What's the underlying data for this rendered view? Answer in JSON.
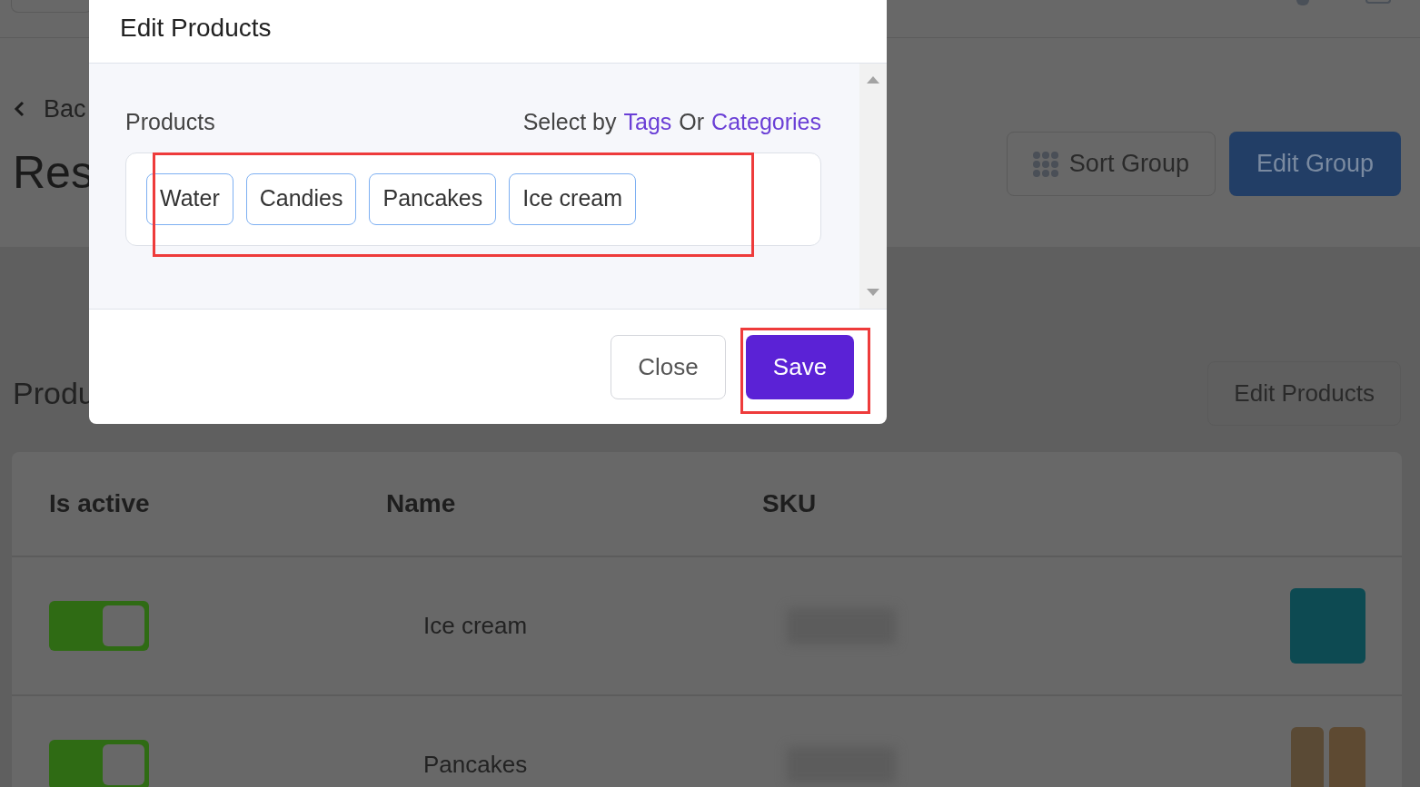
{
  "page": {
    "back_link": "Bac",
    "title": "Res",
    "buttons": [
      {
        "label": "Sort Group",
        "kind": "outline"
      },
      {
        "label": "Edit Group",
        "kind": "primary"
      }
    ],
    "section_title": "Produ",
    "section_button": "Edit Products"
  },
  "table": {
    "columns": [
      "Is active",
      "Name",
      "SKU"
    ],
    "rows": [
      {
        "active": true,
        "name": "Ice cream",
        "kind": "single"
      },
      {
        "active": true,
        "name": "Pancakes",
        "kind": "pair"
      }
    ]
  },
  "dialog": {
    "title": "Edit Products",
    "field_label": "Products",
    "select_by": {
      "prefix": "Select by",
      "links": [
        "Tags",
        "Categories"
      ],
      "separator": "Or"
    },
    "tags": [
      "Water",
      "Candies",
      "Pancakes",
      "Ice cream"
    ],
    "buttons": [
      {
        "label": "Close",
        "kind": "secondary"
      },
      {
        "label": "Save",
        "kind": "primary"
      }
    ]
  }
}
